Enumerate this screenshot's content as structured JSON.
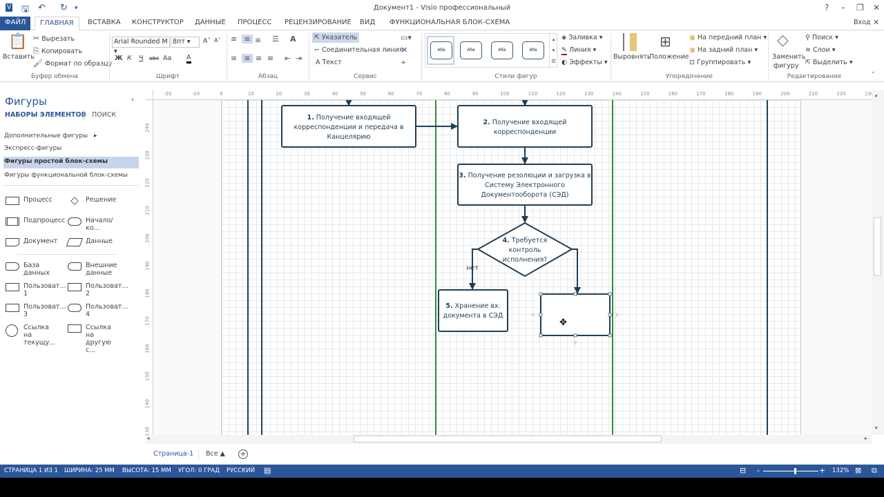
{
  "titlebar": {
    "title": "Документ1 - Visio профессиональный",
    "help": "?",
    "minimize": "–",
    "restore": "❐",
    "close": "✕",
    "signin": "Вход"
  },
  "tabs": [
    "ФАЙЛ",
    "ГЛАВНАЯ",
    "ВСТАВКА",
    "КОНСТРУКТОР",
    "ДАННЫЕ",
    "ПРОЦЕСС",
    "РЕЦЕНЗИРОВАНИЕ",
    "ВИД",
    "ФУНКЦИОНАЛЬНАЯ БЛОК-СХЕМА"
  ],
  "ribbon": {
    "clipboard": {
      "paste": "Вставить",
      "cut": "Вырезать",
      "copy": "Копировать",
      "format_painter": "Формат по образцу",
      "label": "Буфер обмена"
    },
    "font": {
      "family": "Arial Rounded M",
      "size": "8пт",
      "bold": "Ж",
      "italic": "К",
      "underline": "Ч",
      "strike": "abc",
      "case": "Аа",
      "color": "A",
      "label": "Шрифт"
    },
    "paragraph": {
      "label": "Абзац"
    },
    "tools": {
      "pointer": "Указатель",
      "connector": "Соединительная линия",
      "text": "Текст",
      "label": "Сервис"
    },
    "shape_styles": {
      "thumb": "Абв",
      "fill": "Заливка",
      "line": "Линия",
      "effects": "Эффекты",
      "label": "Стили фигур"
    },
    "arrange": {
      "align": "Выровнять",
      "position": "Положение",
      "bring_front": "На передний план",
      "send_back": "На задний план",
      "group": "Группировать",
      "label": "Упорядочение"
    },
    "editing": {
      "change_shape_1": "Заменить",
      "change_shape_2": "фигуру",
      "find": "Поиск",
      "layers": "Слои",
      "select": "Выделить",
      "label": "Редактирование"
    }
  },
  "shapes_panel": {
    "title": "Фигуры",
    "tab_stencils": "НАБОРЫ ЭЛЕМЕНТОВ",
    "tab_search": "ПОИСК",
    "stencils": [
      "Дополнительные фигуры",
      "Экспресс-фигуры",
      "Фигуры простой блок-схемы",
      "Фигуры функциональной блок-схемы"
    ],
    "selected_stencil": "Фигуры простой блок-схемы",
    "shapes": [
      {
        "l1": "Процесс",
        "l2": ""
      },
      {
        "l1": "Решение",
        "l2": ""
      },
      {
        "l1": "Подпроцесс",
        "l2": ""
      },
      {
        "l1": "Начало/ко...",
        "l2": ""
      },
      {
        "l1": "Документ",
        "l2": ""
      },
      {
        "l1": "Данные",
        "l2": ""
      },
      {
        "l1": "База данных",
        "l2": ""
      },
      {
        "l1": "Внешние",
        "l2": "данные"
      },
      {
        "l1": "Пользоват...",
        "l2": "1"
      },
      {
        "l1": "Пользоват...",
        "l2": "2"
      },
      {
        "l1": "Пользоват...",
        "l2": "3"
      },
      {
        "l1": "Пользоват...",
        "l2": "4"
      },
      {
        "l1": "Ссылка на",
        "l2": "текущу..."
      },
      {
        "l1": "Ссылка на",
        "l2": "другую с..."
      }
    ]
  },
  "rulers": {
    "h": [
      "-20",
      "-10",
      "0",
      "10",
      "20",
      "30",
      "40",
      "50",
      "60",
      "70",
      "80",
      "90",
      "100",
      "110",
      "120",
      "130",
      "140",
      "150",
      "160",
      "170",
      "180",
      "190",
      "200",
      "210",
      "220",
      "230"
    ],
    "v": [
      "240",
      "230",
      "220",
      "210",
      "200",
      "190",
      "180",
      "170",
      "160",
      "150",
      "140",
      "130"
    ]
  },
  "diagram": {
    "s1": {
      "num": "1.",
      "l1": " Получение входящей",
      "l2": "корреспонденции и передача в",
      "l3": "Канцелярию"
    },
    "s2": {
      "num": "2.",
      "l1": " Получение входящей",
      "l2": "корреспонденции"
    },
    "s3": {
      "num": "3.",
      "l1": " Получение резолюции и загрузка в",
      "l2": "Систему Электронного",
      "l3": "Документооборота (СЭД)"
    },
    "s4": {
      "num": "4.",
      "l1": " Требуется",
      "l2": "контроль",
      "l3": "исполнения?"
    },
    "s5": {
      "num": "5.",
      "l1": " Хранение вх.",
      "l2": "документа в СЭД"
    },
    "no_label": "нет",
    "colors": {
      "stroke": "#1f3f55",
      "lane": "#1f3f55",
      "lane_green": "#2e8b3e"
    }
  },
  "pages": {
    "page1": "Страница-1",
    "all": "Все ▲",
    "add": "+"
  },
  "status": {
    "page": "СТРАНИЦА 1 ИЗ 1",
    "width": "ШИРИНА: 25 ММ",
    "height": "ВЫСОТА: 15 ММ",
    "angle": "УГОЛ: 0 ГРАД",
    "lang": "РУССКИЙ",
    "zoom": "132%",
    "zoom_level": 132
  },
  "accent": "#2b579a"
}
